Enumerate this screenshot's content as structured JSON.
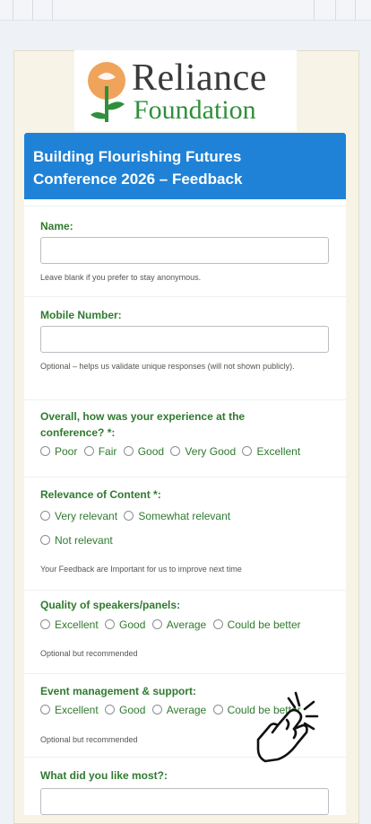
{
  "logo": {
    "line1": "Reliance",
    "line2": "Foundation"
  },
  "form": {
    "title": "Building Flourishing Futures Conference 2026 – Feedback",
    "name": {
      "label": "Name:",
      "hint": "Leave blank if you prefer to stay anonymous."
    },
    "mobile": {
      "label": "Mobile Number:",
      "hint": "Optional – helps us validate unique responses (will not shown publicly)."
    },
    "overall": {
      "label": "Overall, how was your experience at the conference? *:",
      "options": [
        "Poor",
        "Fair",
        "Good",
        "Very Good",
        "Excellent"
      ]
    },
    "relevance": {
      "label": "Relevance of Content *:",
      "options": [
        "Very relevant",
        "Somewhat relevant",
        "Not relevant"
      ],
      "hint": "Your Feedback are Important for us to improve next time"
    },
    "speakers": {
      "label": "Quality of speakers/panels:",
      "options": [
        "Excellent",
        "Good",
        "Average",
        "Could be better"
      ],
      "hint": "Optional but recommended"
    },
    "event": {
      "label": "Event management & support:",
      "options": [
        "Excellent",
        "Good",
        "Average",
        "Could be better"
      ],
      "hint": "Optional but recommended"
    },
    "liked": {
      "label": "What did you like most?:"
    }
  }
}
